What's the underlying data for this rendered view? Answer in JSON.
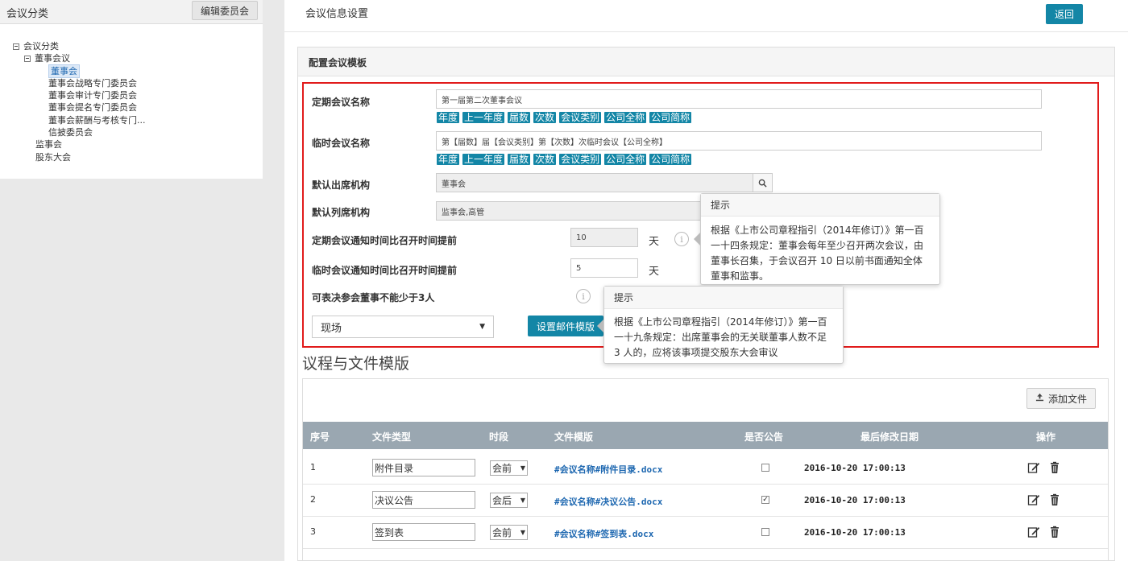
{
  "sidebar": {
    "title": "会议分类",
    "edit_button": "编辑委员会",
    "tree": {
      "root": "会议分类",
      "board": "董事会议",
      "board_children": [
        "董事会",
        "董事会战略专门委员会",
        "董事会审计专门委员会",
        "董事会提名专门委员会",
        "董事会薪酬与考核专门...",
        "信披委员会"
      ],
      "supervisors": "监事会",
      "shareholders": "股东大会"
    }
  },
  "header": {
    "title": "会议信息设置",
    "back_button": "返回"
  },
  "template_panel": {
    "title": "配置会议模板",
    "regular_name_label": "定期会议名称",
    "regular_name_value": "第一届第二次董事会议",
    "temp_name_label": "临时会议名称",
    "temp_name_value": "第【届数】届【会议类别】第【次数】次临时会议【公司全称】",
    "tags": [
      "年度",
      "上一年度",
      "届数",
      "次数",
      "会议类别",
      "公司全称",
      "公司简称"
    ],
    "default_attend_label": "默认出席机构",
    "default_attend_value": "董事会",
    "default_observer_label": "默认列席机构",
    "default_observer_value": "监事会,高管",
    "regular_notice_label": "定期会议通知时间比召开时间提前",
    "regular_notice_value": "10",
    "temp_notice_label": "临时会议通知时间比召开时间提前",
    "temp_notice_value": "5",
    "day_unit": "天",
    "quorum_label": "可表决参会董事不能少于3人",
    "location_value": "现场",
    "mail_template_button": "设置邮件模版"
  },
  "tooltips": [
    {
      "title": "提示",
      "text": "根据《上市公司章程指引（2014年修订）》第一百一十四条规定：董事会每年至少召开两次会议，由董事长召集，于会议召开 10 日以前书面通知全体董事和监事。"
    },
    {
      "title": "提示",
      "text": "根据《上市公司章程指引（2014年修订）》第一百一十九条规定：出席董事会的无关联董事人数不足 3 人的，应将该事项提交股东大会审议"
    }
  ],
  "files_section": {
    "title": "议程与文件模版",
    "add_file_button": "添加文件",
    "columns": [
      "序号",
      "文件类型",
      "时段",
      "文件模版",
      "是否公告",
      "最后修改日期",
      "操作"
    ],
    "rows": [
      {
        "no": "1",
        "type": "附件目录",
        "period": "会前",
        "template": "#会议名称#附件目录.docx",
        "announce": false,
        "date": "2016-10-20  17:00:13"
      },
      {
        "no": "2",
        "type": "决议公告",
        "period": "会后",
        "template": "#会议名称#决议公告.docx",
        "announce": true,
        "date": "2016-10-20  17:00:13"
      },
      {
        "no": "3",
        "type": "签到表",
        "period": "会前",
        "template": "#会议名称#签到表.docx",
        "announce": false,
        "date": "2016-10-20  17:00:13"
      }
    ]
  },
  "colors": {
    "accent": "#1386a6",
    "highlight_border": "#e11b1b",
    "table_header": "#9aa7b1"
  }
}
